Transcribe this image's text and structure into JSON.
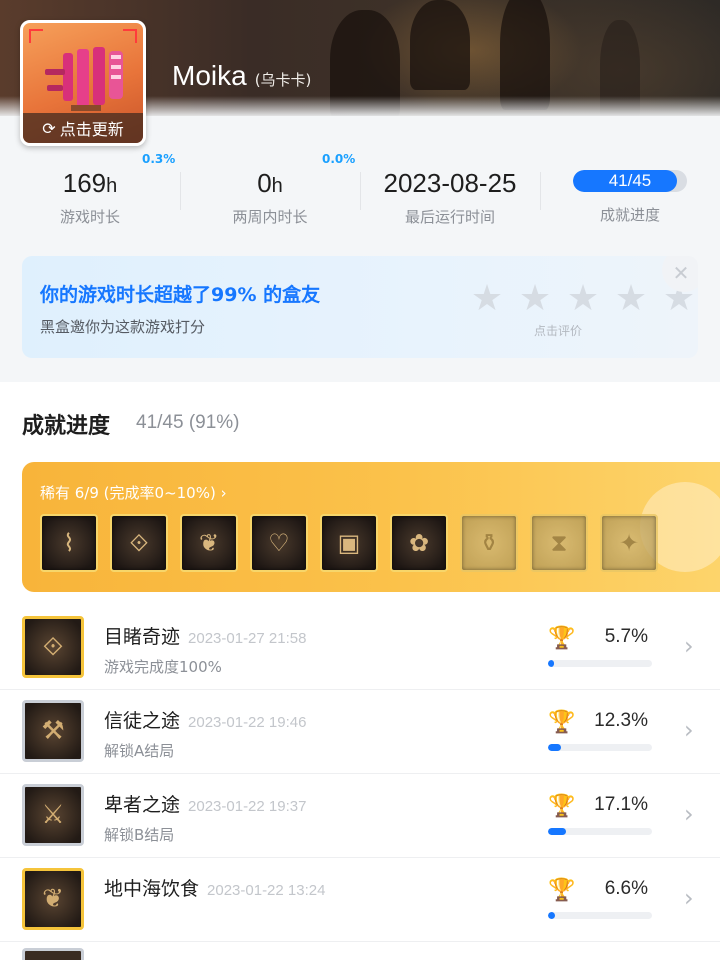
{
  "game": {
    "name": "Moika",
    "subtitle": "(乌卡卡)",
    "update_label": "点击更新"
  },
  "stats": [
    {
      "value": "169",
      "unit": "h",
      "label": "游戏时长",
      "delta": "0.3%"
    },
    {
      "value": "0",
      "unit": "h",
      "label": "两周内时长",
      "delta": "0.0%"
    },
    {
      "value": "2023-08-25",
      "unit": "",
      "label": "最后运行时间",
      "delta": ""
    },
    {
      "value": "41/45",
      "unit": "",
      "label": "成就进度",
      "delta": "",
      "progress": 0.911
    }
  ],
  "rating": {
    "title": "你的游戏时长超越了99% 的盒友",
    "subtitle": "黑盒邀你为这款游戏打分",
    "hint": "点击评价",
    "stars": 5
  },
  "achievements": {
    "title": "成就进度",
    "count": "41/45 (91%)",
    "rare": {
      "label": "稀有 6/9 (完成率0~10%) ›",
      "icons": [
        {
          "icon": "sparkle-icon",
          "glyph": "⌇",
          "unlocked": true
        },
        {
          "icon": "rune-icon",
          "glyph": "⟐",
          "unlocked": true
        },
        {
          "icon": "feast-icon",
          "glyph": "❦",
          "unlocked": true
        },
        {
          "icon": "rosary-icon",
          "glyph": "♡",
          "unlocked": true
        },
        {
          "icon": "book-icon",
          "glyph": "▣",
          "unlocked": true
        },
        {
          "icon": "bouquet-icon",
          "glyph": "✿",
          "unlocked": true
        },
        {
          "icon": "urn-icon",
          "glyph": "⚱",
          "unlocked": false
        },
        {
          "icon": "hourglass-icon",
          "glyph": "⧗",
          "unlocked": false
        },
        {
          "icon": "beast-icon",
          "glyph": "✦",
          "unlocked": false
        }
      ]
    },
    "list": [
      {
        "name": "目睹奇迹",
        "date": "2023-01-27 21:58",
        "desc": "游戏完成度100%",
        "pct": "5.7%",
        "rate": 0.057,
        "tier": "gold",
        "glyph": "⟐"
      },
      {
        "name": "信徒之途",
        "date": "2023-01-22 19:46",
        "desc": "解锁A结局",
        "pct": "12.3%",
        "rate": 0.123,
        "tier": "silver",
        "glyph": "⚒"
      },
      {
        "name": "卑者之途",
        "date": "2023-01-22 19:37",
        "desc": "解锁B结局",
        "pct": "17.1%",
        "rate": 0.171,
        "tier": "silver",
        "glyph": "⚔"
      },
      {
        "name": "地中海饮食",
        "date": "2023-01-22 13:24",
        "desc": "",
        "pct": "6.6%",
        "rate": 0.066,
        "tier": "gold",
        "glyph": "❦"
      }
    ]
  },
  "colors": {
    "accent": "#1677ff",
    "gold": "#f5c43b",
    "rare_card": "#fbc24b"
  }
}
